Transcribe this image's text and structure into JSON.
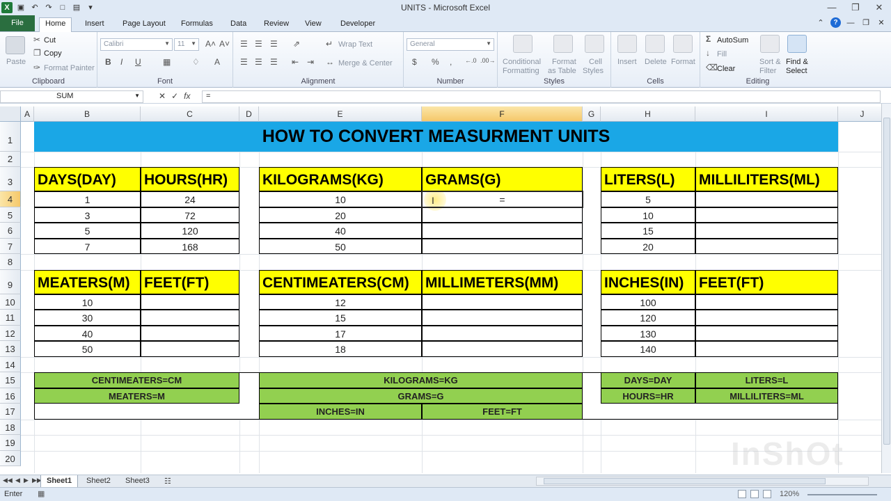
{
  "window": {
    "title": "UNITS - Microsoft Excel"
  },
  "ribbon_tabs": [
    "File",
    "Home",
    "Insert",
    "Page Layout",
    "Formulas",
    "Data",
    "Review",
    "View",
    "Developer"
  ],
  "ribbon": {
    "clipboard": {
      "paste": "Paste",
      "cut": "Cut",
      "copy": "Copy",
      "format_painter": "Format Painter",
      "label": "Clipboard"
    },
    "font": {
      "name": "Calibri",
      "size": "11",
      "label": "Font"
    },
    "alignment": {
      "wrap": "Wrap Text",
      "merge": "Merge & Center",
      "label": "Alignment"
    },
    "number": {
      "format": "General",
      "label": "Number"
    },
    "styles": {
      "cond": "Conditional",
      "cond2": "Formatting",
      "fmt_table": "Format",
      "fmt_table2": "as Table",
      "cell_styles": "Cell",
      "cell_styles2": "Styles",
      "label": "Styles"
    },
    "cells": {
      "insert": "Insert",
      "delete": "Delete",
      "format": "Format",
      "label": "Cells"
    },
    "editing": {
      "autosum": "AutoSum",
      "fill": "Fill",
      "clear": "Clear",
      "sort": "Sort &",
      "sort2": "Filter",
      "find": "Find &",
      "find2": "Select",
      "label": "Editing"
    }
  },
  "formula_bar": {
    "name_box": "SUM",
    "formula": "="
  },
  "columns": [
    "A",
    "B",
    "C",
    "D",
    "E",
    "F",
    "G",
    "H",
    "I",
    "J"
  ],
  "rows": [
    "1",
    "2",
    "3",
    "4",
    "5",
    "6",
    "7",
    "8",
    "9",
    "10",
    "11",
    "12",
    "13",
    "14",
    "15",
    "16",
    "17",
    "18",
    "19",
    "20"
  ],
  "sheet": {
    "title": "HOW TO CONVERT MEASURMENT UNITS",
    "headers": {
      "b3": "DAYS(DAY)",
      "c3": "HOURS(HR)",
      "e3": "KILOGRAMS(KG)",
      "f3": "GRAMS(G)",
      "h3": "LITERS(L)",
      "i3": "MILLILITERS(ML)",
      "b9": "MEATERS(M)",
      "c9": "FEET(FT)",
      "e9": "CENTIMEATERS(CM)",
      "f9": "MILLIMETERS(MM)",
      "h9": "INCHES(IN)",
      "i9": "FEET(FT)"
    },
    "days": [
      "1",
      "3",
      "5",
      "7"
    ],
    "hours": [
      "24",
      "72",
      "120",
      "168"
    ],
    "kilograms": [
      "10",
      "20",
      "40",
      "50"
    ],
    "liters": [
      "5",
      "10",
      "15",
      "20"
    ],
    "meaters": [
      "10",
      "30",
      "40",
      "50"
    ],
    "centimeaters": [
      "12",
      "15",
      "17",
      "18"
    ],
    "inches": [
      "100",
      "120",
      "130",
      "140"
    ],
    "editing_value": "=",
    "legend": {
      "cm": "CENTIMEATERS=CM",
      "m": "MEATERS=M",
      "kg": "KILOGRAMS=KG",
      "g": "GRAMS=G",
      "in": "INCHES=IN",
      "ft": "FEET=FT",
      "day": "DAYS=DAY",
      "hr": "HOURS=HR",
      "l": "LITERS=L",
      "ml": "MILLILITERS=ML"
    }
  },
  "sheet_tabs": [
    "Sheet1",
    "Sheet2",
    "Sheet3"
  ],
  "status": {
    "mode": "Enter",
    "zoom": "120%"
  },
  "watermark": "InShOt"
}
